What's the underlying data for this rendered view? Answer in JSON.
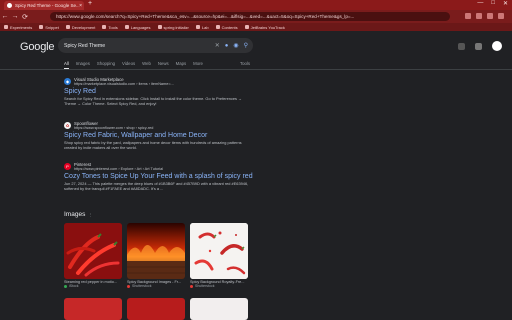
{
  "browser": {
    "tab_title": "Spicy Red Theme - Google Se...",
    "tab_close": "×",
    "new_tab": "+",
    "controls": [
      "—",
      "□",
      "✕"
    ],
    "url": "https://www.google.com/search?q=Spicy+Red+Theme&sca_esv=...&source=hp&ei=...&iflsig=...&ved=...&uact=5&oq=Spicy+Red+Theme&gs_lp=...",
    "nav": [
      "←",
      "→",
      "⟳"
    ],
    "bookmarks": [
      "Experiments",
      "Snippet",
      "Development",
      "Tools",
      "Languages",
      "spring initializr",
      "Lab",
      "Contents",
      "JetBrains YouTrack"
    ]
  },
  "google": {
    "logo": "Google",
    "query": "Spicy Red Theme",
    "tabs": [
      "All",
      "Images",
      "Shopping",
      "Videos",
      "Web",
      "News",
      "Maps",
      "More"
    ],
    "tools": "Tools"
  },
  "results": [
    {
      "source": "Visual Studio Marketplace",
      "url": "https://marketplace.visualstudio.com › items › itemName=...",
      "title": "Spicy Red",
      "snippet": "Search for Spicy Red in extensions sidebar. Click Install to install the color theme. Go to Preferences → Theme → Color Theme. Select Spicy Red, and enjoy!",
      "favicon_color": "#2b7bd6"
    },
    {
      "source": "Spoonflower",
      "url": "https://www.spoonflower.com › shop › spicy-red",
      "title": "Spicy Red Fabric, Wallpaper and Home Decor",
      "snippet": "Shop spicy red fabric by the yard, wallpapers and home decor items with hundreds of amazing patterns created by indie makers all over the world.",
      "favicon_color": "#f2f2f2"
    },
    {
      "source": "Pinterest",
      "url": "https://www.pinterest.com › Explore › Art › Art Tutorial",
      "title": "Cozy Tones to Spice Up Your Feed with a splash of spicy red",
      "snippet": "Jun 27, 2024 — This palette merges the deep blues of #1B3B6F and #457B9D with a vibrant red #E63946, softened by the tranquil #F1FAEE and #A8DADC. It's a ...",
      "favicon_color": "#e60023"
    }
  ],
  "images": {
    "heading": "Images",
    "items": [
      {
        "caption": "Steaming red pepper in motio...",
        "source": "iStock"
      },
      {
        "caption": "Spicy Background Images - Fr...",
        "source": "Shutterstock"
      },
      {
        "caption": "Spicy Background Royalty-Fre...",
        "source": "Shutterstock"
      }
    ]
  }
}
